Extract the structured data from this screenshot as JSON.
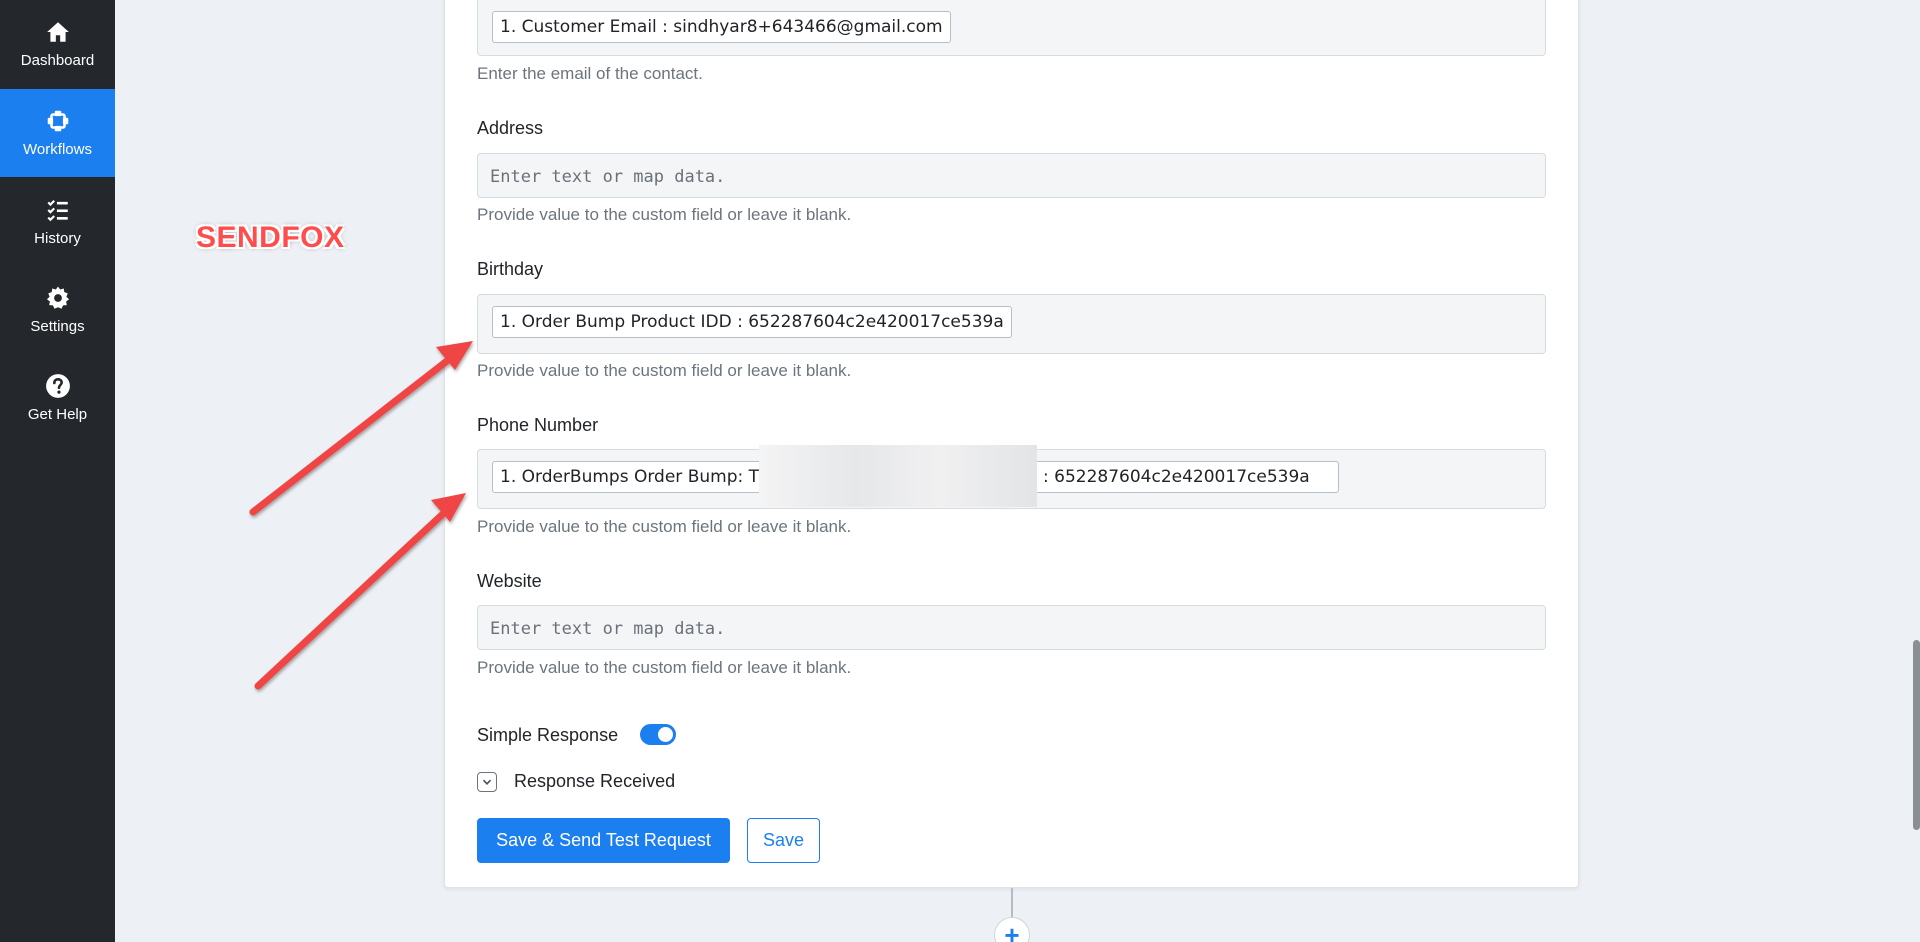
{
  "sidebar": {
    "items": [
      {
        "label": "Dashboard",
        "icon": "home-icon"
      },
      {
        "label": "Workflows",
        "icon": "workflow-icon",
        "active": true
      },
      {
        "label": "History",
        "icon": "list-check-icon"
      },
      {
        "label": "Settings",
        "icon": "gear-icon"
      },
      {
        "label": "Get Help",
        "icon": "question-circle-icon"
      }
    ],
    "active_color": "#1b7ff0",
    "background": "#24282d"
  },
  "annotation": {
    "label": "SENDFOX",
    "color": "#ff4d4d"
  },
  "form": {
    "email": {
      "tag": "1. Customer Email : sindhyar8+643466@gmail.com",
      "help": "Enter the email of the contact."
    },
    "address": {
      "label": "Address",
      "placeholder": "Enter text or map data.",
      "help": "Provide value to the custom field or leave it blank."
    },
    "birthday": {
      "label": "Birthday",
      "tag": "1. Order Bump Product IDD : 652287604c2e420017ce539a",
      "help": "Provide value to the custom field or leave it blank."
    },
    "phone": {
      "label": "Phone Number",
      "tag_prefix": "1. OrderBumps Order Bump: T",
      "tag_suffix": ": 652287604c2e420017ce539a",
      "help": "Provide value to the custom field or leave it blank."
    },
    "website": {
      "label": "Website",
      "placeholder": "Enter text or map data.",
      "help": "Provide value to the custom field or leave it blank."
    },
    "simple_response": {
      "label": "Simple Response",
      "enabled": true
    },
    "response_received": {
      "label": "Response Received"
    },
    "buttons": {
      "primary": "Save & Send Test Request",
      "secondary": "Save"
    },
    "add_step": "+"
  }
}
